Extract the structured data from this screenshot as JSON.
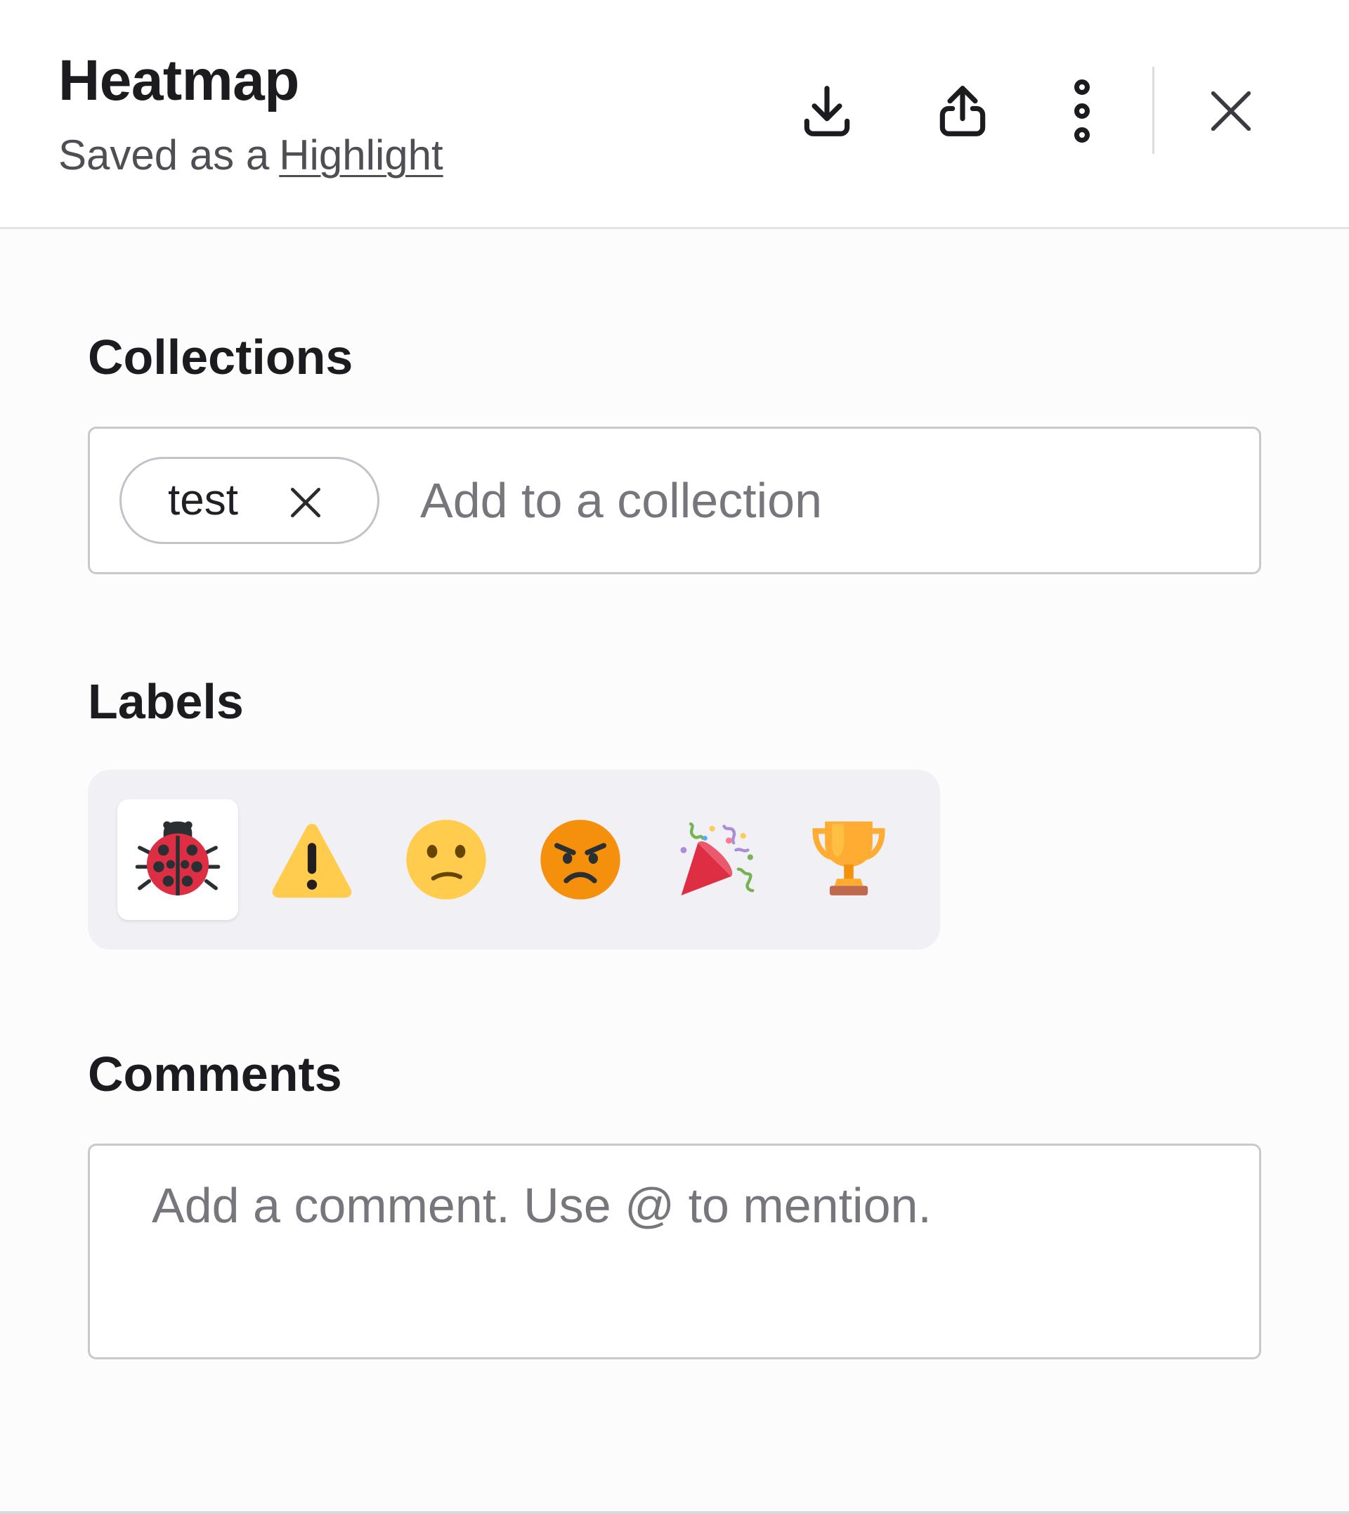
{
  "header": {
    "title": "Heatmap",
    "subtitle_prefix": "Saved as a",
    "subtitle_link": "Highlight",
    "actions": {
      "download_icon": "download-icon",
      "share_icon": "share-icon",
      "more_icon": "more-vertical-icon",
      "close_icon": "close-icon"
    }
  },
  "collections": {
    "heading": "Collections",
    "tags": [
      {
        "label": "test",
        "remove_icon": "close-icon"
      }
    ],
    "input_value": "",
    "input_placeholder": "Add to a collection"
  },
  "labels": {
    "heading": "Labels",
    "items": [
      {
        "name": "bug",
        "icon": "ladybug-icon",
        "selected": true
      },
      {
        "name": "warning",
        "icon": "warning-icon",
        "selected": false
      },
      {
        "name": "confused",
        "icon": "confused-face-icon",
        "selected": false
      },
      {
        "name": "angry",
        "icon": "angry-face-icon",
        "selected": false
      },
      {
        "name": "party",
        "icon": "party-popper-icon",
        "selected": false
      },
      {
        "name": "trophy",
        "icon": "trophy-icon",
        "selected": false
      }
    ]
  },
  "comments": {
    "heading": "Comments",
    "input_value": "",
    "input_placeholder": "Add a comment. Use @ to mention."
  },
  "colors": {
    "text_primary": "#1c1c20",
    "text_secondary": "#4f4e55",
    "placeholder": "#77767d",
    "border": "#c9c8cd",
    "labels_bg": "#f1f0f5",
    "ladybug_red": "#dd2e44",
    "warning_yellow": "#ffcc4d",
    "angry_orange": "#f4900c",
    "trophy_gold": "#ffac33"
  }
}
